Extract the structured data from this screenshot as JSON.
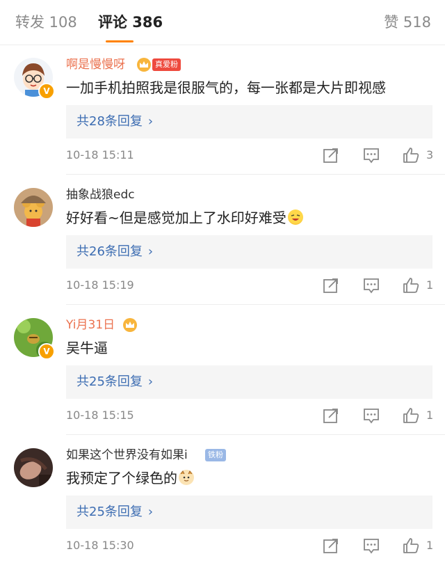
{
  "tabs": {
    "repost": "转发 108",
    "comments": "评论 386",
    "likes": "赞 518"
  },
  "colors": {
    "accent": "#ff8200",
    "link": "#3d6db2",
    "vip_name": "#eb7350"
  },
  "comments": [
    {
      "username": "啊是慢慢呀",
      "fan_tag": "真爱粉",
      "text": "一加手机拍照我是很服气的，每一张都是大片即视感",
      "replies": "共28条回复",
      "time": "10-18 15:11",
      "likes": "3"
    },
    {
      "username": "抽象战狼edc",
      "text": "好好看~但是感觉加上了水印好难受",
      "replies": "共26条回复",
      "time": "10-18 15:19",
      "likes": "1"
    },
    {
      "username": "Yi月31日",
      "text": "吴牛逼",
      "replies": "共25条回复",
      "time": "10-18 15:15",
      "likes": "1"
    },
    {
      "username": "如果这个世界没有如果i",
      "fan_tag": "铁粉",
      "text": "我预定了个绿色的",
      "replies": "共25条回复",
      "time": "10-18 15:30",
      "likes": "1"
    }
  ],
  "icons": [
    "crown-icon",
    "share-icon",
    "reply-icon",
    "like-icon",
    "verified-icon",
    "emoji-icon"
  ]
}
